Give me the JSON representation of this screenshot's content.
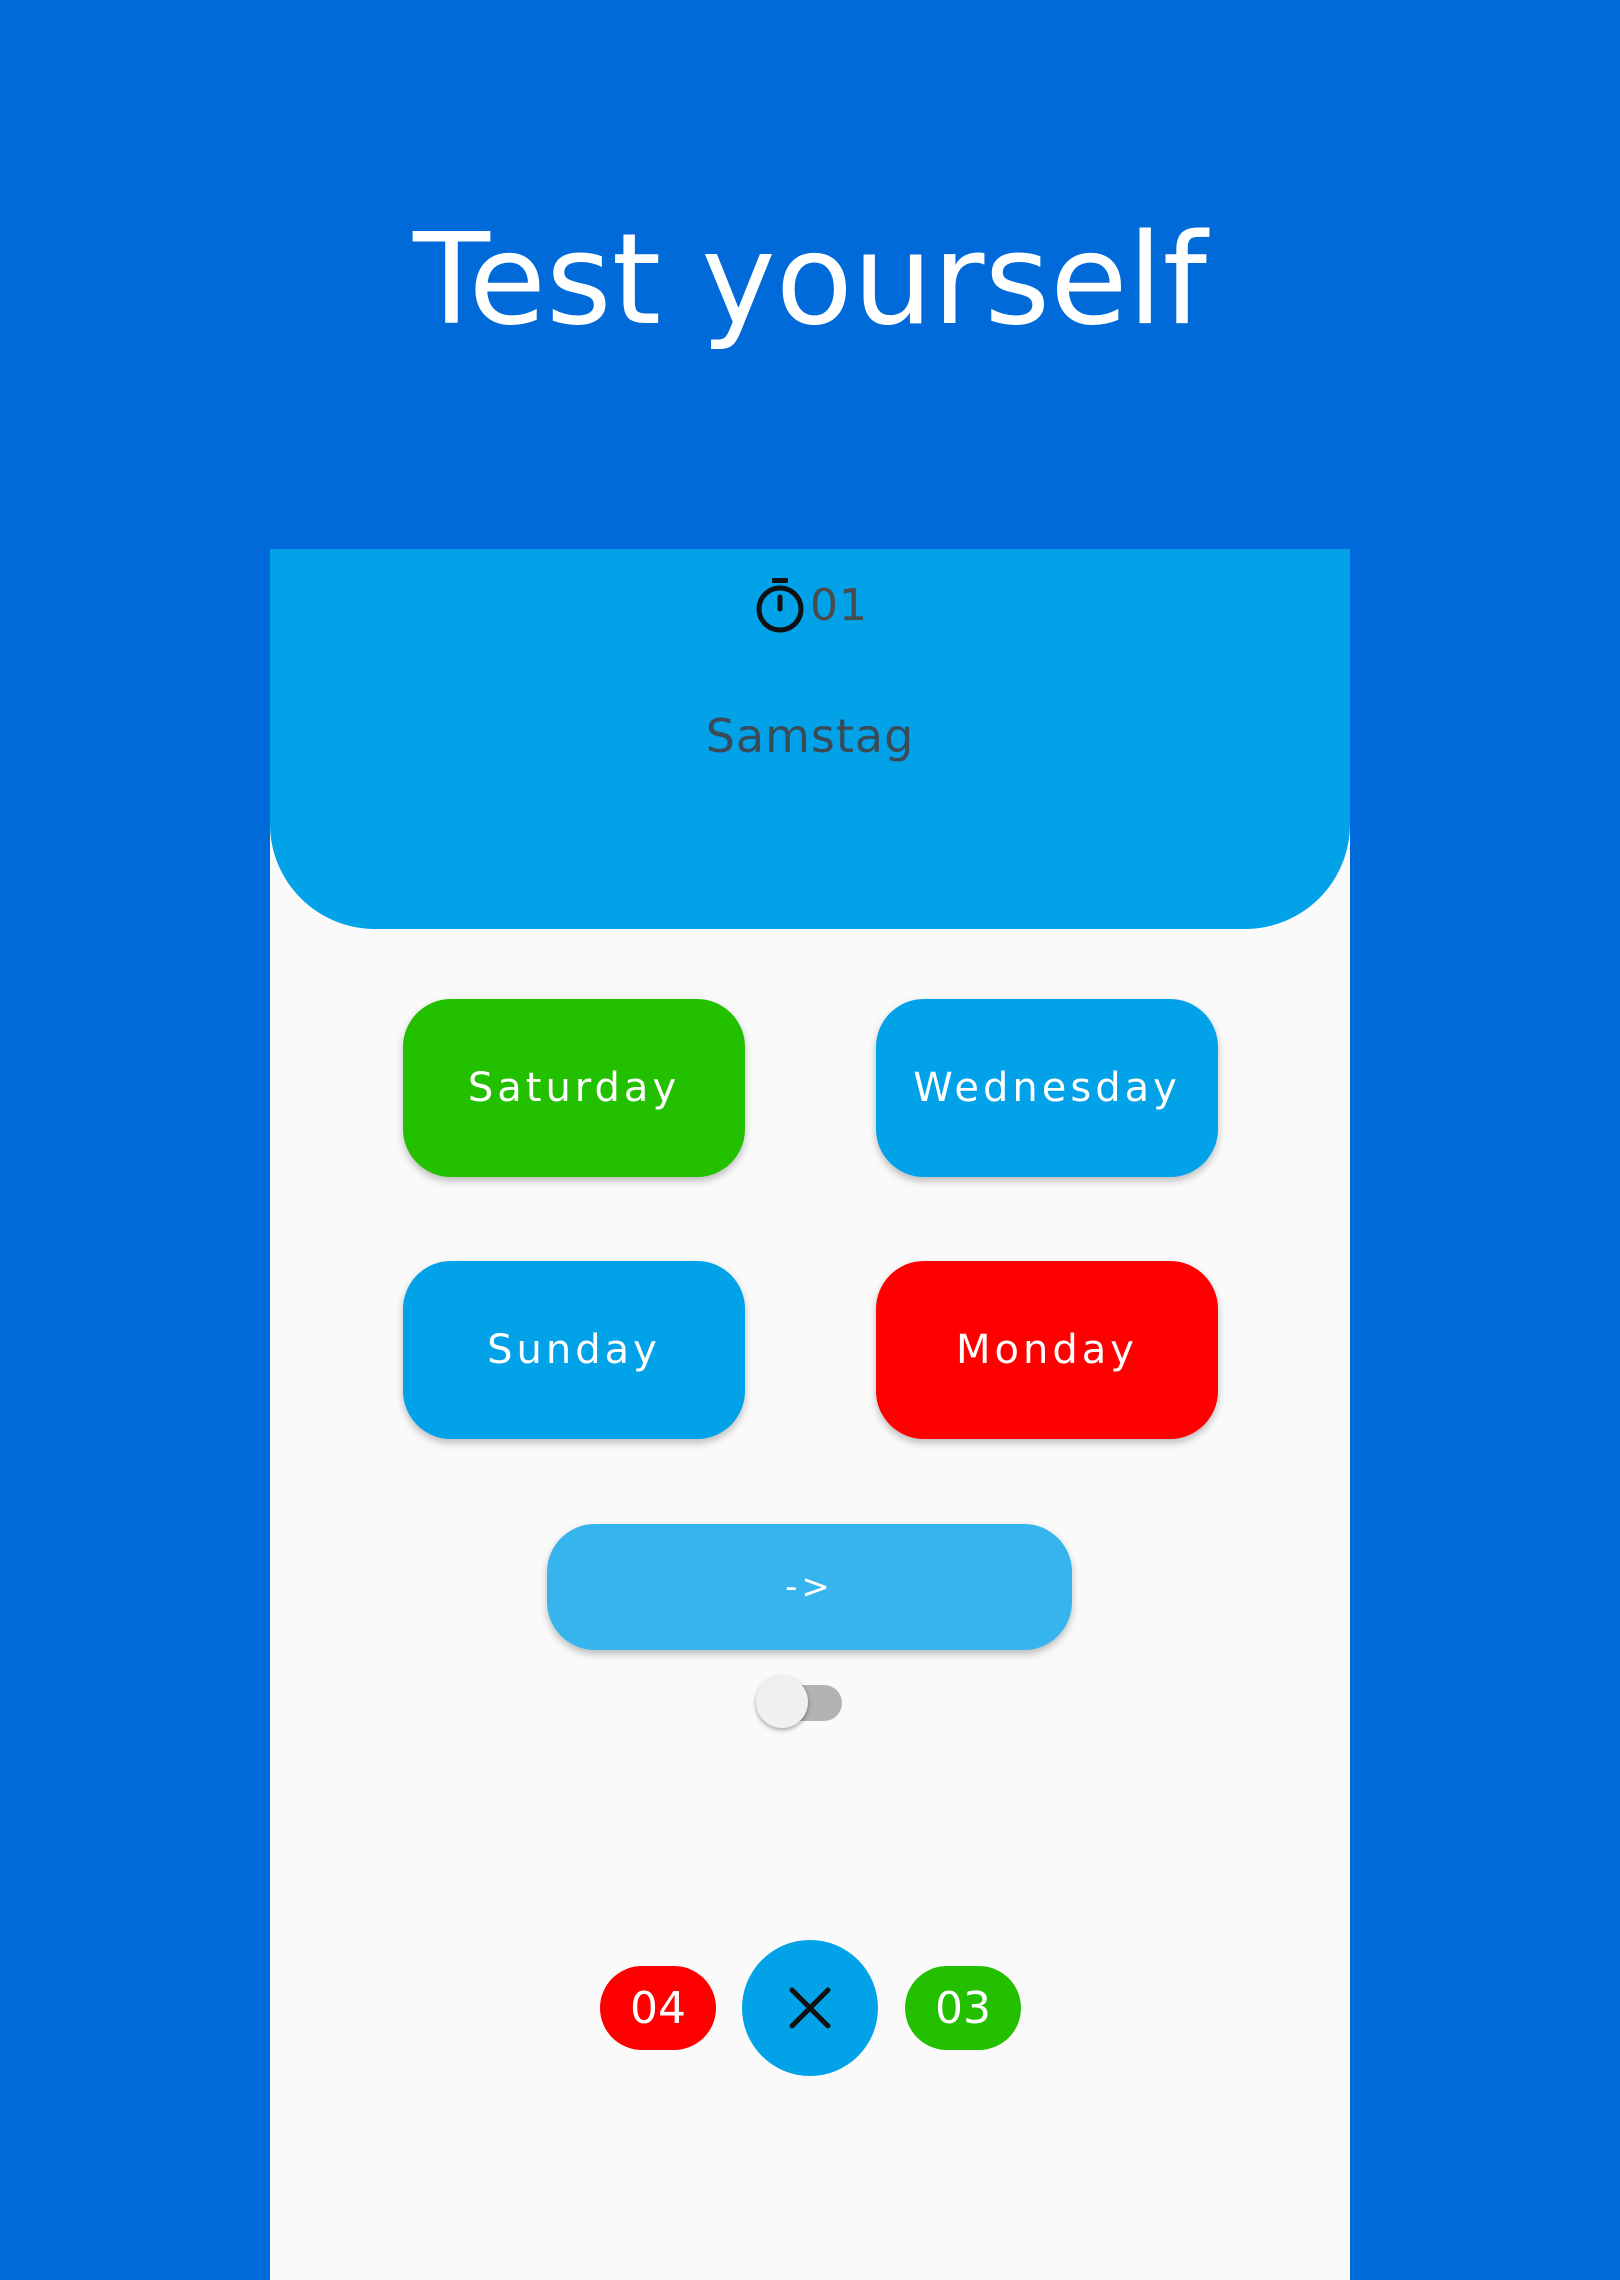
{
  "headline": "Test yourself",
  "quiz": {
    "timer_value": "01",
    "word": "Samstag",
    "answers": [
      {
        "label": "Saturday",
        "state": "correct",
        "color": "#23c000"
      },
      {
        "label": "Wednesday",
        "state": "neutral",
        "color": "#02a2e8"
      },
      {
        "label": "Sunday",
        "state": "neutral",
        "color": "#02a2e8"
      },
      {
        "label": "Monday",
        "state": "wrong",
        "color": "#ff0000"
      }
    ],
    "next_label": "->",
    "toggle_on": false,
    "score": {
      "wrong": "04",
      "right": "03"
    }
  },
  "icons": {
    "timer": "stopwatch-icon",
    "close": "close-icon"
  },
  "colors": {
    "background": "#006ad8",
    "panel": "#02a2e8",
    "correct": "#23c000",
    "wrong": "#ff0000",
    "next_button": "#36b4ee"
  }
}
